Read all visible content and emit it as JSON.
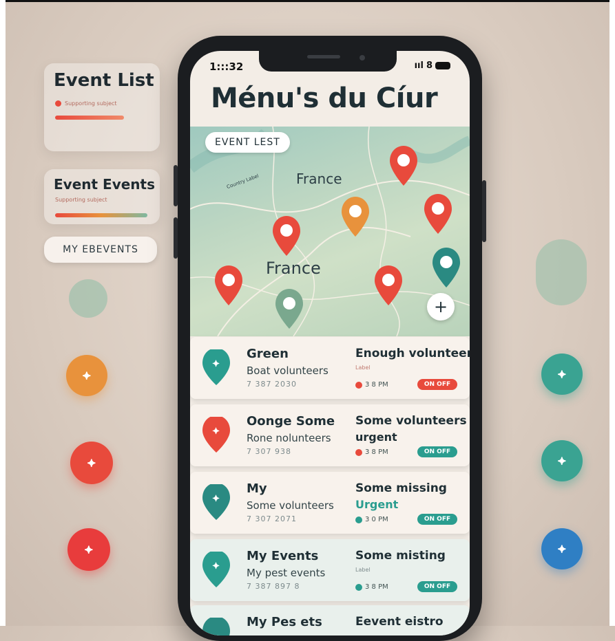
{
  "left_panel": {
    "cards": [
      {
        "title": "Event List",
        "subtitle": "Supporting subject"
      },
      {
        "title": "Event Events",
        "subtitle": "Supporting subject"
      }
    ],
    "pill_button": "MY EBEVENTS"
  },
  "status_bar": {
    "time": "1:::32",
    "signal": "ııl",
    "carrier": "8"
  },
  "app": {
    "title": "Ménu's du Cíur",
    "chip_label": "EVENT LEST",
    "map_labels": [
      "France",
      "France"
    ],
    "small_label": "Country Label",
    "add_button": "+"
  },
  "events": [
    {
      "name": "Green",
      "meta": "Boat volunteers",
      "date": "7 387 2030",
      "status": "Enough volunteers",
      "subnote": "Label",
      "time": "3 8 PM",
      "toggle": "ON OFF",
      "color": "#2a9d8f"
    },
    {
      "name": "Oonge Some",
      "meta": "Rone nolunteers",
      "date": "7 307 938",
      "status": "Some volunteers",
      "sub_status": "urgent",
      "time": "3 8 PM",
      "toggle": "ON OFF",
      "color": "#e84a3c"
    },
    {
      "name": "My",
      "meta": "Some volunteers",
      "date": "7 307 2071",
      "status": "Some missing",
      "sub_status": "Urgent",
      "time": "3 0 PM",
      "toggle": "ON OFF",
      "color": "#2a8a82"
    },
    {
      "name": "My Events",
      "meta": "My pest events",
      "date": "7 387 897 8",
      "status": "Some misting",
      "subnote": "Label",
      "time": "3 8 PM",
      "toggle": "ON OFF",
      "color": "#2a9d8f"
    },
    {
      "name": "My Pes ets",
      "meta": "",
      "date": "",
      "status": "Eevent eistro",
      "time": "",
      "toggle": "",
      "color": "#2a8a82"
    }
  ],
  "colors": {
    "red": "#e84a3c",
    "orange": "#e8923c",
    "teal": "#2a9d8f",
    "blue": "#2f7fc4",
    "dark": "#1f2f35"
  }
}
